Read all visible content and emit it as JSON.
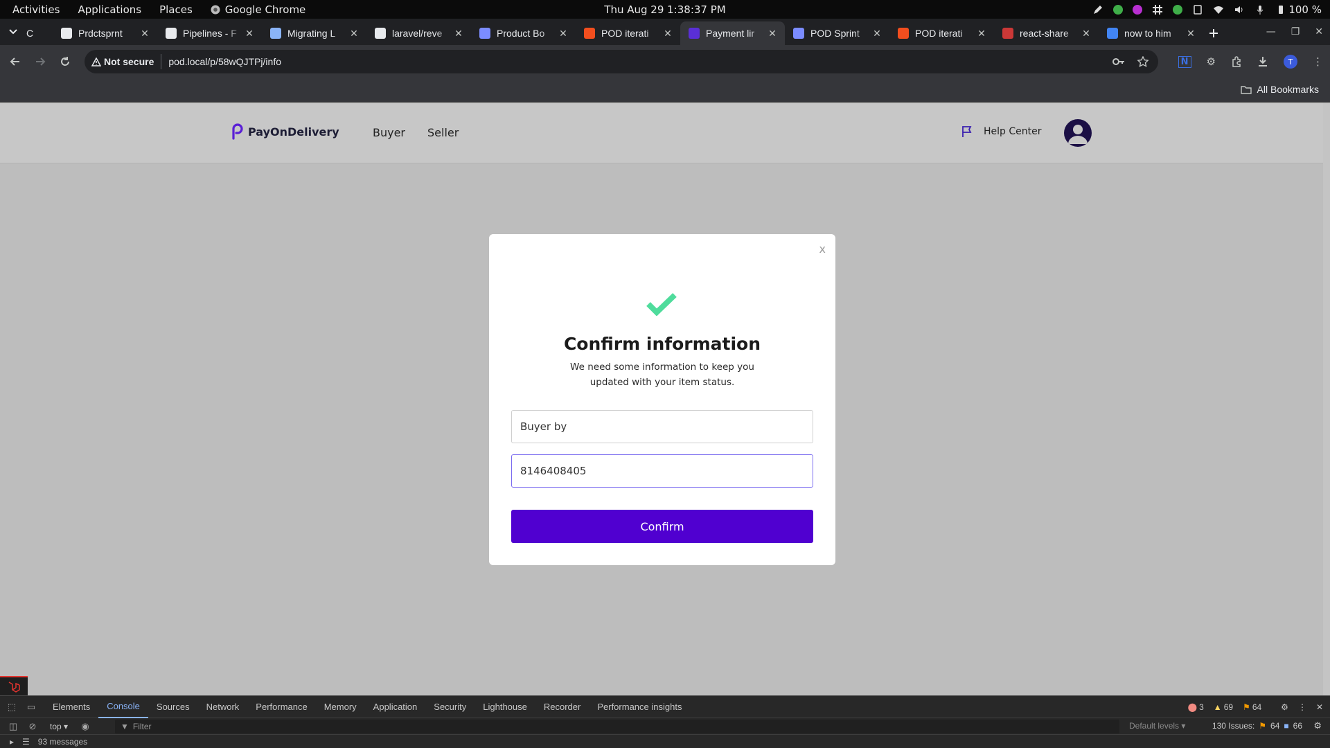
{
  "gnome": {
    "activities": "Activities",
    "applications": "Applications",
    "places": "Places",
    "app_name": "Google Chrome",
    "clock": "Thu Aug 29   1:38:37 PM",
    "battery": "100 %"
  },
  "tabs": [
    {
      "title": "C",
      "short": true
    },
    {
      "title": "Prdctsprnt",
      "icon": "github-icon",
      "color": "#e8eaed"
    },
    {
      "title": "Pipelines - F",
      "icon": "pipelines-icon",
      "color": "#e8eaed"
    },
    {
      "title": "Migrating L",
      "icon": "migrate-icon",
      "color": "#8ab4f8"
    },
    {
      "title": "laravel/reve",
      "icon": "github-icon",
      "color": "#e8eaed"
    },
    {
      "title": "Product Bo",
      "icon": "jira-icon",
      "color": "#7b8cff"
    },
    {
      "title": "POD iterati",
      "icon": "figma-icon",
      "color": "#f24e1e"
    },
    {
      "title": "Payment lir",
      "icon": "pod-icon",
      "color": "#5a2fd6",
      "active": true
    },
    {
      "title": "POD Sprint",
      "icon": "jira-icon",
      "color": "#7b8cff"
    },
    {
      "title": "POD iterati",
      "icon": "figma-icon",
      "color": "#f24e1e"
    },
    {
      "title": "react-share",
      "icon": "npm-icon",
      "color": "#cb3837"
    },
    {
      "title": "now to him",
      "icon": "google-icon",
      "color": "#4285f4"
    }
  ],
  "address": {
    "security_label": "Not secure",
    "url": "pod.local/p/58wQJTPj/info"
  },
  "bookmarks": {
    "all_label": "All Bookmarks"
  },
  "site": {
    "brand": "PayOnDelivery",
    "nav": [
      "Buyer",
      "Seller"
    ],
    "help": "Help Center"
  },
  "modal": {
    "close": "x",
    "title": "Confirm information",
    "subtitle": "We need some information to keep you updated with your item status.",
    "name_value": "Buyer by",
    "phone_value": "8146408405",
    "confirm_label": "Confirm"
  },
  "devtools": {
    "tabs": [
      "Elements",
      "Console",
      "Sources",
      "Network",
      "Performance",
      "Memory",
      "Application",
      "Security",
      "Lighthouse",
      "Recorder",
      "Performance insights"
    ],
    "active_tab": "Console",
    "errors": "3",
    "warnings": "69",
    "info": "64",
    "context": "top",
    "filter_placeholder": "Filter",
    "levels": "Default levels",
    "issues_label": "130 Issues:",
    "issues_a": "64",
    "issues_b": "66",
    "messages": "93 messages"
  },
  "colors": {
    "brand_purple": "#5000d0",
    "check_green": "#4fdc9c"
  }
}
